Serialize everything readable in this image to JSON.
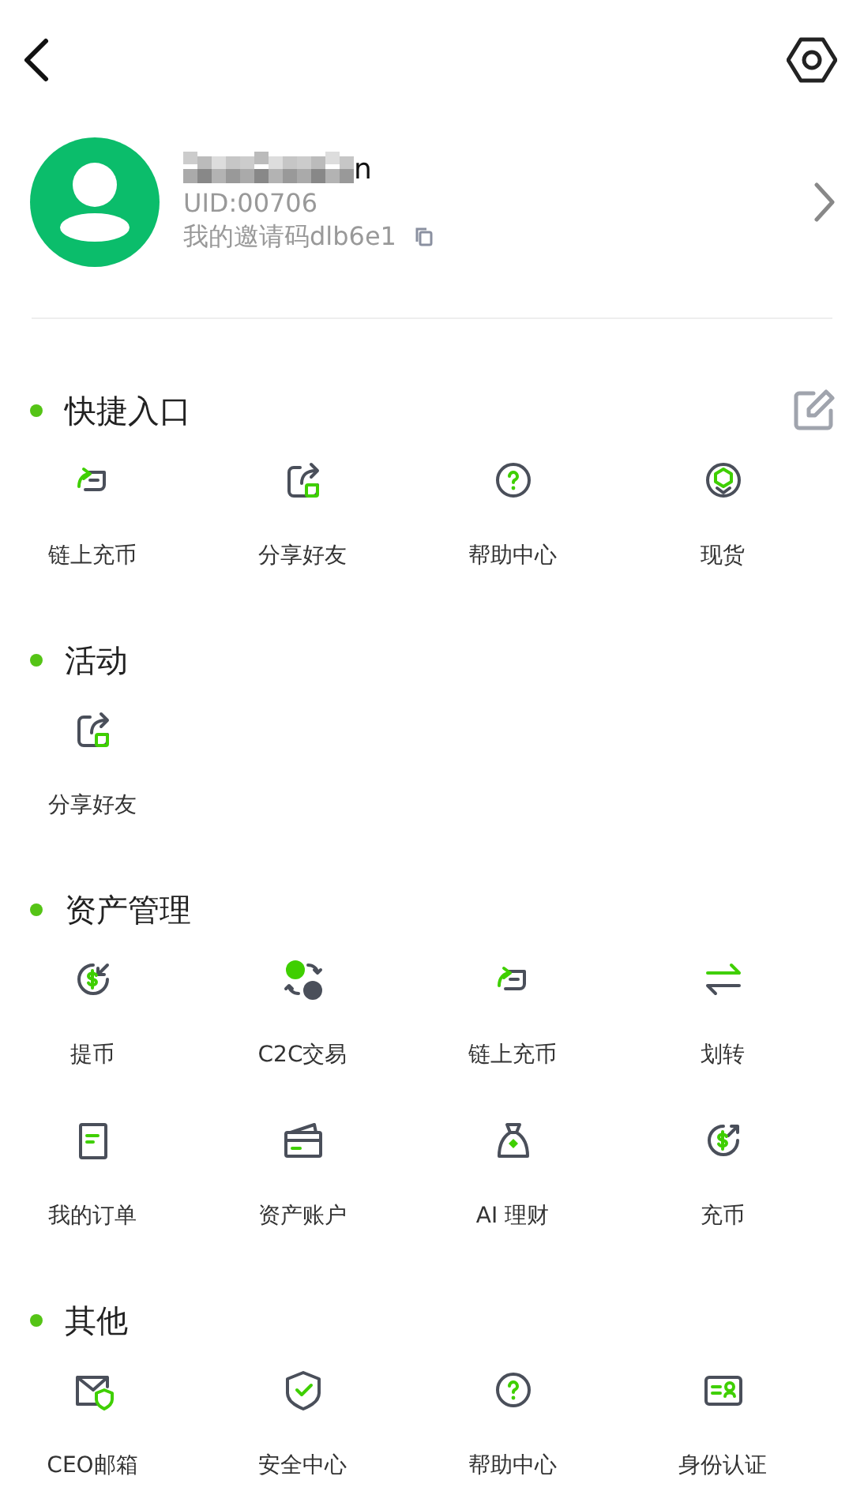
{
  "profile": {
    "name": "n",
    "uid": "UID:00706",
    "invite": "我的邀请码dlb6e1"
  },
  "sections": [
    {
      "title": "快捷入口",
      "editable": true,
      "items": [
        {
          "kind": "chain",
          "label": "链上充币"
        },
        {
          "kind": "share",
          "label": "分享好友"
        },
        {
          "kind": "help",
          "label": "帮助中心"
        },
        {
          "kind": "spot",
          "label": "现货"
        }
      ]
    },
    {
      "title": "活动",
      "editable": false,
      "items": [
        {
          "kind": "share",
          "label": "分享好友"
        }
      ]
    },
    {
      "title": "资产管理",
      "editable": false,
      "items": [
        {
          "kind": "withdraw",
          "label": "提币"
        },
        {
          "kind": "c2c",
          "label": "C2C交易"
        },
        {
          "kind": "chain",
          "label": "链上充币"
        },
        {
          "kind": "transfer",
          "label": "划转"
        },
        {
          "kind": "orders",
          "label": "我的订单"
        },
        {
          "kind": "account",
          "label": "资产账户"
        },
        {
          "kind": "bag",
          "label": "AI 理财"
        },
        {
          "kind": "deposit",
          "label": "充币"
        }
      ]
    },
    {
      "title": "其他",
      "editable": false,
      "items": [
        {
          "kind": "mail",
          "label": "CEO邮箱"
        },
        {
          "kind": "shield",
          "label": "安全中心"
        },
        {
          "kind": "help",
          "label": "帮助中心"
        },
        {
          "kind": "idcard",
          "label": "身份认证"
        }
      ]
    }
  ]
}
